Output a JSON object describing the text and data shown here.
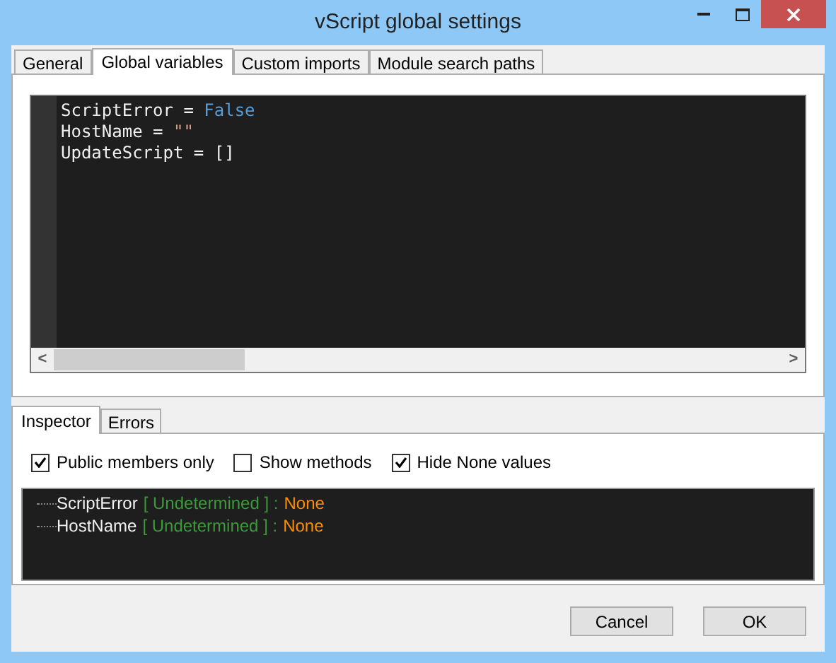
{
  "window": {
    "title": "vScript global settings"
  },
  "tabs": [
    {
      "label": "General",
      "selected": false
    },
    {
      "label": "Global variables",
      "selected": true
    },
    {
      "label": "Custom imports",
      "selected": false
    },
    {
      "label": "Module search paths",
      "selected": false
    }
  ],
  "editor": {
    "lines": [
      [
        {
          "text": "ScriptError = ",
          "kind": "plain"
        },
        {
          "text": "False",
          "kind": "keyword"
        }
      ],
      [
        {
          "text": "HostName = ",
          "kind": "plain"
        },
        {
          "text": "\"\"",
          "kind": "string"
        }
      ],
      [
        {
          "text": "UpdateScript = []",
          "kind": "plain"
        }
      ]
    ],
    "scroll_left": "<",
    "scroll_right": ">"
  },
  "bottom_tabs": [
    {
      "label": "Inspector",
      "selected": true
    },
    {
      "label": "Errors",
      "selected": false
    }
  ],
  "options": [
    {
      "label": "Public members only",
      "checked": true
    },
    {
      "label": "Show methods",
      "checked": false
    },
    {
      "label": "Hide None values",
      "checked": true
    }
  ],
  "inspector": [
    {
      "name": "ScriptError",
      "detail": "[ Undetermined ] :",
      "value": "None"
    },
    {
      "name": "HostName",
      "detail": "[ Undetermined ] :",
      "value": "None"
    }
  ],
  "buttons": [
    "Cancel",
    "OK"
  ]
}
